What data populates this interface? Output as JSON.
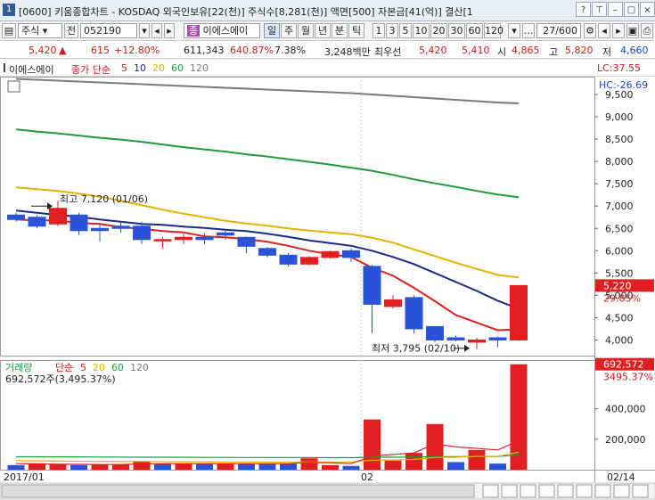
{
  "window": {
    "number": "1",
    "title": "[0600] 키움종합차트 - KOSDAQ 외국인보유[22(천)] 주식수[8,281(천)] 액면[500] 자본금[41(억)] 결산[1"
  },
  "toolbar": {
    "market": "주식",
    "prev_label": "전",
    "code": "052190",
    "stock_name": "이에스에이",
    "periods": [
      "일",
      "주",
      "월",
      "년",
      "분",
      "틱"
    ],
    "active_period": "일",
    "intervals": [
      "1",
      "3",
      "5",
      "10",
      "20",
      "30",
      "60",
      "120"
    ],
    "count": "27/600"
  },
  "quote": {
    "price": "5,420",
    "change": "615",
    "change_pct": "+12.80%",
    "volume": "611,343",
    "volume_ratio": "640.87%",
    "turnover": "7.38%",
    "amount": "3,248백만",
    "best_label": "최우선",
    "ask": "5,420",
    "bid": "5,410",
    "open_label": "시",
    "open": "4,865",
    "high_label": "고",
    "high": "5,820",
    "low_label": "저",
    "low": "4,660"
  },
  "chart_data": [
    {
      "type": "candlestick",
      "title": "이에스에이",
      "indicator_label": "종가 단순",
      "ma_periods": [
        "5",
        "10",
        "20",
        "60",
        "120"
      ],
      "ma_colors": [
        "#e02020",
        "#1a2a8a",
        "#e8b000",
        "#1f9a3a",
        "#7a7a7a"
      ],
      "ylim": [
        3650,
        9900
      ],
      "yticks": [
        4000,
        4500,
        5000,
        5500,
        6000,
        6500,
        7000,
        7500,
        8000,
        8500,
        9000,
        9500
      ],
      "ytick_labels": [
        "4,000",
        "4,500",
        "5,000",
        "5,500",
        "6,000",
        "6,500",
        "7,000",
        "7,500",
        "8,000",
        "8,500",
        "9,000",
        "9,500"
      ],
      "x_labels": [
        "2017/01",
        "02",
        "02/14"
      ],
      "right_labels": {
        "lc": "LC:37.55",
        "hc": "HC:-26.69",
        "last_price": "5,220",
        "last_pct": "29.85%"
      },
      "annotations": {
        "high": "최고 7,120 (01/06)",
        "low": "최저 3,795 (02/10)"
      },
      "candles": [
        {
          "o": 6800,
          "h": 6850,
          "l": 6650,
          "c": 6700
        },
        {
          "o": 6750,
          "h": 6800,
          "l": 6500,
          "c": 6550
        },
        {
          "o": 6600,
          "h": 7120,
          "l": 6550,
          "c": 6950
        },
        {
          "o": 6800,
          "h": 6850,
          "l": 6350,
          "c": 6450
        },
        {
          "o": 6500,
          "h": 6600,
          "l": 6200,
          "c": 6450
        },
        {
          "o": 6550,
          "h": 6650,
          "l": 6400,
          "c": 6500
        },
        {
          "o": 6550,
          "h": 6650,
          "l": 6150,
          "c": 6250
        },
        {
          "o": 6250,
          "h": 6300,
          "l": 6050,
          "c": 6250
        },
        {
          "o": 6250,
          "h": 6380,
          "l": 6150,
          "c": 6300
        },
        {
          "o": 6300,
          "h": 6400,
          "l": 6150,
          "c": 6250
        },
        {
          "o": 6400,
          "h": 6450,
          "l": 6250,
          "c": 6350
        },
        {
          "o": 6300,
          "h": 6320,
          "l": 5950,
          "c": 6100
        },
        {
          "o": 6050,
          "h": 6080,
          "l": 5850,
          "c": 5900
        },
        {
          "o": 5900,
          "h": 5950,
          "l": 5650,
          "c": 5700
        },
        {
          "o": 5700,
          "h": 5880,
          "l": 5680,
          "c": 5850
        },
        {
          "o": 5850,
          "h": 6000,
          "l": 5820,
          "c": 5980
        },
        {
          "o": 6000,
          "h": 6050,
          "l": 5750,
          "c": 5850
        },
        {
          "o": 5650,
          "h": 5680,
          "l": 4150,
          "c": 4800
        },
        {
          "o": 4750,
          "h": 5000,
          "l": 4700,
          "c": 4900
        },
        {
          "o": 4950,
          "h": 5000,
          "l": 4150,
          "c": 4250
        },
        {
          "o": 4300,
          "h": 4320,
          "l": 3950,
          "c": 4000
        },
        {
          "o": 4050,
          "h": 4100,
          "l": 3970,
          "c": 4000
        },
        {
          "o": 3950,
          "h": 4050,
          "l": 3795,
          "c": 4000
        },
        {
          "o": 4050,
          "h": 4080,
          "l": 3850,
          "c": 4000
        },
        {
          "o": 4000,
          "h": 5220,
          "l": 3980,
          "c": 5220
        }
      ],
      "ma5": [
        6700,
        6680,
        6680,
        6620,
        6600,
        6530,
        6490,
        6440,
        6410,
        6320,
        6300,
        6260,
        6200,
        6110,
        6000,
        5920,
        5860,
        5620,
        5440,
        5170,
        4870,
        4560,
        4390,
        4220,
        4240
      ],
      "ma10": [
        6900,
        6850,
        6800,
        6760,
        6700,
        6650,
        6600,
        6580,
        6540,
        6510,
        6470,
        6440,
        6380,
        6310,
        6230,
        6170,
        6110,
        6000,
        5860,
        5700,
        5500,
        5300,
        5100,
        4880,
        4700
      ],
      "ma20": [
        7420,
        7380,
        7340,
        7280,
        7210,
        7120,
        7020,
        6920,
        6830,
        6750,
        6670,
        6610,
        6560,
        6500,
        6450,
        6410,
        6370,
        6290,
        6180,
        6030,
        5880,
        5730,
        5590,
        5460,
        5400
      ],
      "ma60": [
        8720,
        8670,
        8630,
        8580,
        8530,
        8490,
        8440,
        8380,
        8320,
        8270,
        8220,
        8160,
        8110,
        8050,
        7990,
        7930,
        7860,
        7790,
        7700,
        7600,
        7510,
        7430,
        7340,
        7260,
        7200
      ],
      "ma120": [
        9850,
        9830,
        9810,
        9790,
        9770,
        9750,
        9730,
        9710,
        9690,
        9670,
        9650,
        9630,
        9610,
        9590,
        9570,
        9550,
        9530,
        9500,
        9470,
        9440,
        9410,
        9380,
        9350,
        9320,
        9300
      ]
    },
    {
      "type": "bar",
      "title": "거래량",
      "indicator_label": "단순",
      "ma_periods": [
        "5",
        "20",
        "60",
        "120"
      ],
      "ma_colors": [
        "#e02020",
        "#e8b000",
        "#1f9a3a",
        "#7a7a7a"
      ],
      "info": "692,572주(3,495.37%)",
      "ylim": [
        0,
        720000
      ],
      "yticks": [
        200000,
        400000
      ],
      "ytick_labels": [
        "200,000",
        "400,000"
      ],
      "right_labels": {
        "last_value": "692,572",
        "last_pct": "3495.37%"
      },
      "values": [
        30000,
        42000,
        38000,
        30000,
        34000,
        36000,
        55000,
        40000,
        38000,
        40000,
        42000,
        40000,
        38000,
        40000,
        75000,
        30000,
        25000,
        330000,
        60000,
        110000,
        300000,
        50000,
        130000,
        40000,
        692572
      ],
      "up": [
        false,
        true,
        true,
        false,
        true,
        true,
        true,
        false,
        true,
        false,
        true,
        false,
        false,
        false,
        true,
        true,
        false,
        true,
        true,
        true,
        true,
        false,
        true,
        false,
        true
      ],
      "ma5": [
        40000,
        38000,
        36000,
        35000,
        34000,
        34000,
        38000,
        40000,
        40000,
        40000,
        40000,
        40000,
        40000,
        40000,
        48000,
        45000,
        40000,
        90000,
        100000,
        110000,
        170000,
        150000,
        140000,
        130000,
        190000
      ],
      "ma20": [
        60000,
        58000,
        57000,
        56000,
        55000,
        54000,
        54000,
        53000,
        52000,
        52000,
        51000,
        51000,
        50000,
        50000,
        51000,
        50000,
        50000,
        62000,
        64000,
        68000,
        80000,
        82000,
        88000,
        88000,
        115000
      ],
      "ma60": [
        85000,
        85000,
        84000,
        84000,
        83000,
        83000,
        82000,
        82000,
        82000,
        81000,
        81000,
        80000,
        80000,
        80000,
        80000,
        79000,
        79000,
        82000,
        82000,
        83000,
        86000,
        86000,
        87000,
        87000,
        97000
      ]
    }
  ]
}
